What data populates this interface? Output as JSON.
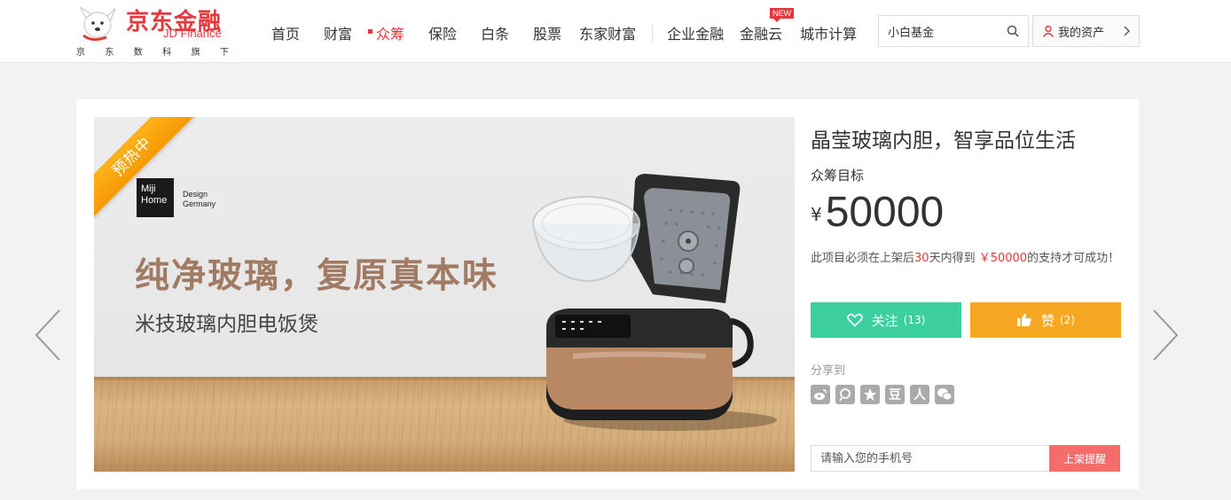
{
  "header": {
    "logo_cn": "京东金融",
    "logo_en": "JD Finance",
    "logo_sub": [
      "京",
      "东",
      "数",
      "科",
      "旗",
      "下"
    ],
    "nav": [
      {
        "label": "首页",
        "active": false
      },
      {
        "label": "财富",
        "active": false
      },
      {
        "label": "众筹",
        "active": true
      },
      {
        "label": "保险",
        "active": false
      },
      {
        "label": "白条",
        "active": false
      },
      {
        "label": "股票",
        "active": false
      },
      {
        "label": "东家财富",
        "active": false
      },
      {
        "label": "企业金融",
        "active": false
      },
      {
        "label": "金融云",
        "active": false,
        "badge": "NEW"
      },
      {
        "label": "城市计算",
        "active": false
      }
    ],
    "search_value": "小白基金",
    "assets_label": "我的资产"
  },
  "banner": {
    "ribbon": "预热中",
    "brand_name": "Miji Home",
    "brand_name_lines": [
      "Miji",
      "Home"
    ],
    "brand_tag_lines": [
      "Design",
      "Germany"
    ],
    "headline": "纯净玻璃，复原真本味",
    "subline": "米技玻璃内胆电饭煲"
  },
  "project": {
    "title": "晶莹玻璃内胆，智享品位生活",
    "goal_label": "众筹目标",
    "currency": "¥",
    "goal_amount": "50000",
    "desc_prefix": "此项目必须在上架后",
    "desc_days": "30",
    "desc_mid": "天内得到",
    "desc_amount": "￥50000",
    "desc_suffix": "的支持才可成功！",
    "follow_label": "关注",
    "follow_count": "(13)",
    "like_label": "赞",
    "like_count": "(2)",
    "share_label": "分享到",
    "share_icons": [
      "weibo-icon",
      "qzone-icon",
      "star-icon",
      "douban-icon",
      "renren-icon",
      "wechat-icon"
    ],
    "share_glyphs": [
      "豆",
      "人"
    ],
    "phone_placeholder": "请输入您的手机号",
    "remind_label": "上架提醒"
  },
  "colors": {
    "brand_red": "#e4393c",
    "follow_green": "#3dcfa0",
    "like_orange": "#f7a823",
    "ribbon_orange": "#f59a00",
    "remind_red": "#f56c6c"
  }
}
